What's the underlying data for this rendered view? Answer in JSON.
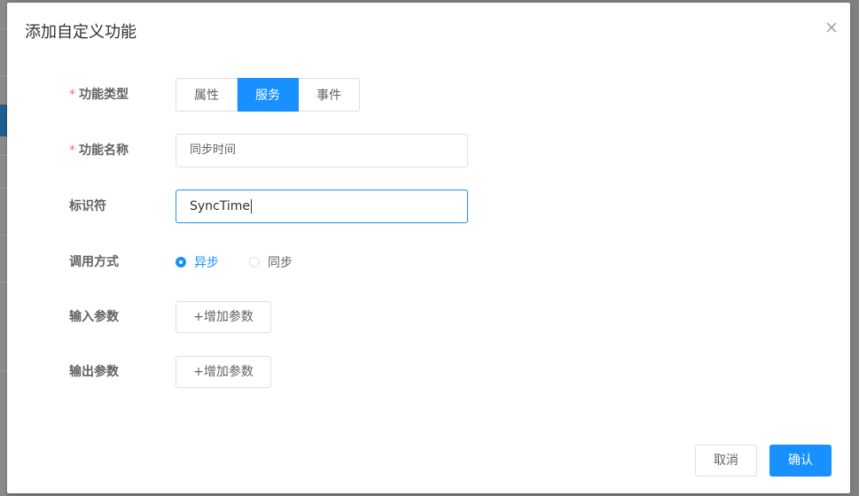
{
  "dialog": {
    "title": "添加自定义功能",
    "close_icon": "close-icon"
  },
  "form": {
    "function_type": {
      "label": "功能类型",
      "required": "*",
      "options": [
        "属性",
        "服务",
        "事件"
      ],
      "selected": "服务"
    },
    "function_name": {
      "label": "功能名称",
      "required": "*",
      "value": "同步时间"
    },
    "identifier": {
      "label": "标识符",
      "value": "SyncTime"
    },
    "call_mode": {
      "label": "调用方式",
      "options": [
        "异步",
        "同步"
      ],
      "selected": "异步"
    },
    "input_params": {
      "label": "输入参数",
      "button": "+增加参数"
    },
    "output_params": {
      "label": "输出参数",
      "button": "+增加参数"
    }
  },
  "footer": {
    "cancel_label": "取消",
    "confirm_label": "确认"
  },
  "colors": {
    "accent": "#1890ff",
    "required": "#f56c6c"
  }
}
